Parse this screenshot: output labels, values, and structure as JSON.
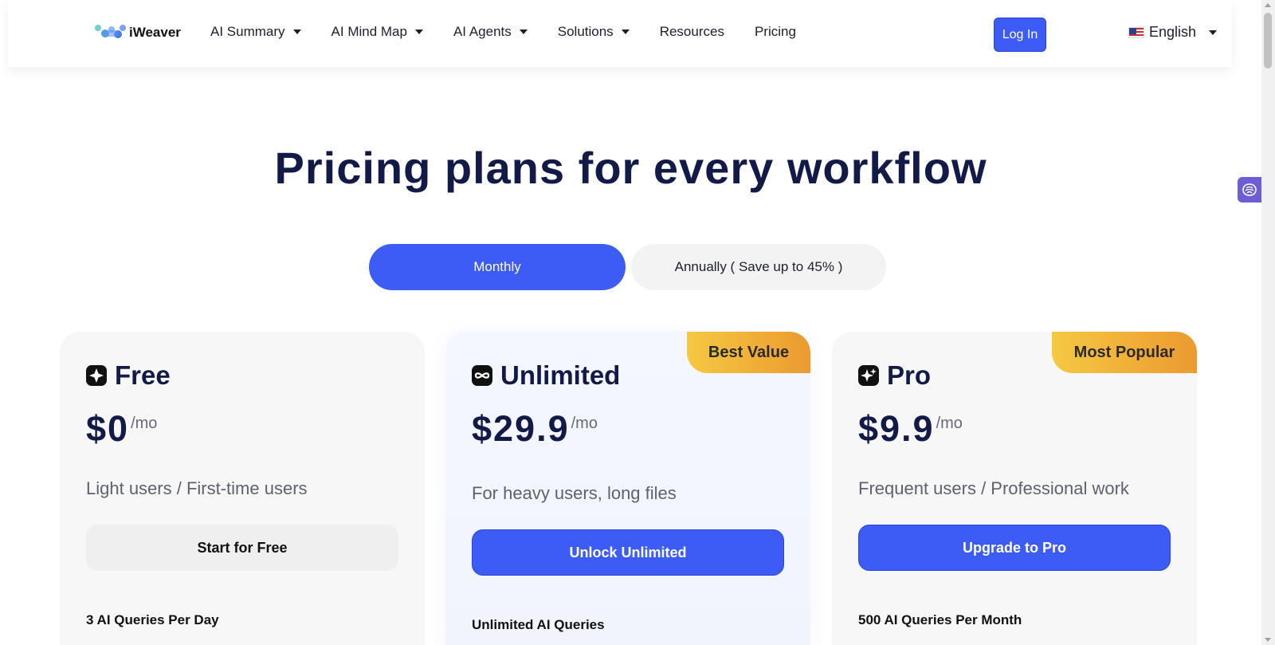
{
  "brand": {
    "name": "iWeaver"
  },
  "nav": {
    "items": [
      {
        "label": "AI Summary",
        "has_dropdown": true
      },
      {
        "label": "AI Mind Map",
        "has_dropdown": true
      },
      {
        "label": "AI Agents",
        "has_dropdown": true
      },
      {
        "label": "Solutions",
        "has_dropdown": true
      },
      {
        "label": "Resources",
        "has_dropdown": false
      },
      {
        "label": "Pricing",
        "has_dropdown": false
      }
    ],
    "login_label": "Log In",
    "language": "English"
  },
  "page": {
    "title": "Pricing plans for every workflow"
  },
  "billing_toggle": {
    "monthly_label": "Monthly",
    "annual_label": "Annually ( Save up to 45% )",
    "selected": "monthly"
  },
  "plans": [
    {
      "name": "Free",
      "icon": "sparkle-icon",
      "price": "$0",
      "period": "/mo",
      "description": "Light users / First-time users",
      "cta": "Start for Free",
      "feature": "3 AI Queries Per Day"
    },
    {
      "name": "Unlimited",
      "icon": "infinity-icon",
      "badge": "Best Value",
      "price": "$29.9",
      "period": "/mo",
      "description": "For heavy users, long files",
      "cta": "Unlock Unlimited",
      "feature": "Unlimited AI Queries"
    },
    {
      "name": "Pro",
      "icon": "sparkles-icon",
      "badge": "Most Popular",
      "price": "$9.9",
      "period": "/mo",
      "description": "Frequent users / Professional work",
      "cta": "Upgrade to Pro",
      "feature": "500 AI Queries Per Month"
    }
  ],
  "colors": {
    "primary": "#3d5cf5",
    "title": "#121a48",
    "badge_start": "#f5c842",
    "badge_end": "#ec9a30",
    "side_widget": "#6b5ed6"
  }
}
